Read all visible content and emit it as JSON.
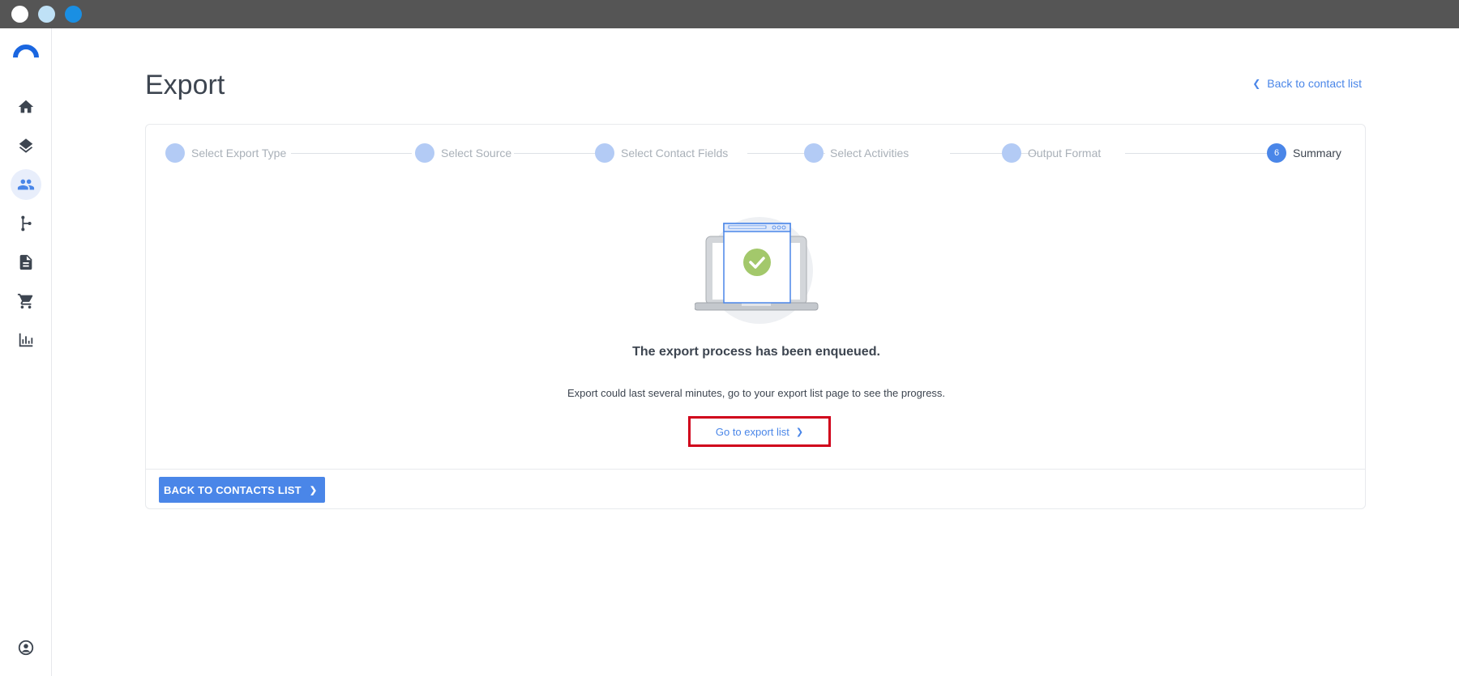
{
  "window": {
    "controls": [
      "close",
      "minimize",
      "maximize"
    ]
  },
  "sidebar": {
    "items": [
      {
        "icon": "home-icon",
        "active": false
      },
      {
        "icon": "layers-icon",
        "active": false
      },
      {
        "icon": "contacts-icon",
        "active": true
      },
      {
        "icon": "workflow-icon",
        "active": false
      },
      {
        "icon": "document-icon",
        "active": false
      },
      {
        "icon": "cart-icon",
        "active": false
      },
      {
        "icon": "chart-icon",
        "active": false
      }
    ],
    "bottom_icon": "account-icon"
  },
  "header": {
    "title": "Export",
    "back_link": "Back to contact list"
  },
  "stepper": {
    "steps": [
      {
        "label": "Select Export Type",
        "number": "",
        "state": "done"
      },
      {
        "label": "Select Source",
        "number": "",
        "state": "done"
      },
      {
        "label": "Select Contact Fields",
        "number": "",
        "state": "done"
      },
      {
        "label": "Select Activities",
        "number": "",
        "state": "done"
      },
      {
        "label": "Output Format",
        "number": "",
        "state": "done"
      },
      {
        "label": "Summary",
        "number": "6",
        "state": "current"
      }
    ]
  },
  "summary": {
    "title": "The export process has been enqueued.",
    "body": "Export could last several minutes, go to your export list page to see the progress.",
    "go_link": "Go to export list"
  },
  "footer": {
    "button": "BACK TO CONTACTS LIST"
  },
  "colors": {
    "accent": "#4a86e8",
    "step_done": "#b3cbf5",
    "success": "#a3c86b",
    "highlight": "#d0021b",
    "titlebar": "#555555"
  }
}
